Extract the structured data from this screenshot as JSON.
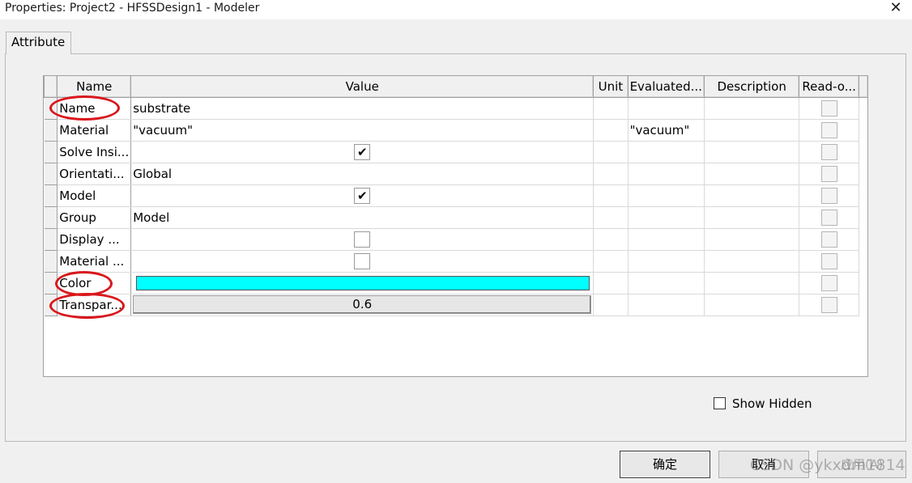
{
  "window": {
    "title": "Properties: Project2 - HFSSDesign1 - Modeler",
    "close_glyph": "✕"
  },
  "tab": {
    "label": "Attribute"
  },
  "grid": {
    "headers": {
      "name": "Name",
      "value": "Value",
      "unit": "Unit",
      "evaluated": "Evaluated...",
      "description": "Description",
      "readonly": "Read-o..."
    },
    "rows": [
      {
        "name": "Name",
        "value": "substrate",
        "evaluated": ""
      },
      {
        "name": "Material",
        "value": "\"vacuum\"",
        "evaluated": "\"vacuum\""
      },
      {
        "name": "Solve Insi...",
        "checked": true
      },
      {
        "name": "Orientati...",
        "value": "Global"
      },
      {
        "name": "Model",
        "checked": true
      },
      {
        "name": "Group",
        "value": "Model"
      },
      {
        "name": "Display ...",
        "checked": false
      },
      {
        "name": "Material ...",
        "checked": false
      },
      {
        "name": "Color",
        "color": "#00ffff"
      },
      {
        "name": "Transpar...",
        "value": "0.6"
      }
    ]
  },
  "show_hidden": {
    "label": "Show Hidden",
    "checked": false
  },
  "buttons": {
    "ok": "确定",
    "cancel": "取消",
    "apply": "应用(A)"
  },
  "watermark": "CSDN @ykxdm1814",
  "annotation_color": "#d9171c"
}
